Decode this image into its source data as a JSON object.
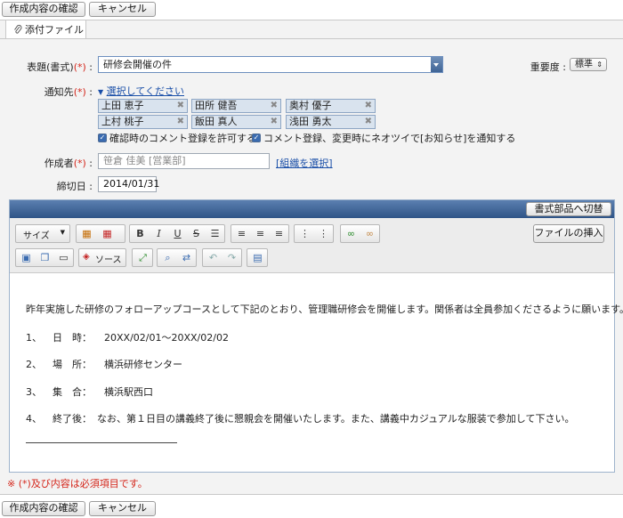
{
  "top_buttons": {
    "confirm": "作成内容の確認",
    "cancel": "キャンセル"
  },
  "tab": {
    "label": "添付ファイル"
  },
  "form": {
    "title_label": "表題(書式)",
    "required_mark": "(*)",
    "colon": ":",
    "title_value": "研修会開催の件",
    "importance_label": "重要度",
    "importance_value": "標準",
    "notify_label": "通知先",
    "notify_select_link": "選択してください",
    "recipients": [
      "上田 恵子",
      "田所 健吾",
      "奥村 優子",
      "上村 桃子",
      "飯田 真人",
      "浅田 勇太"
    ],
    "allow_comment_label": "確認時のコメント登録を許可する",
    "notify_new_label": "コメント登録、変更時にネオツイで[お知らせ]を通知する",
    "author_label": "作成者",
    "author_value": "笹倉 佳美 [営業部]",
    "org_select_link": "[組織を選択]",
    "deadline_label": "締切日",
    "deadline_value": "2014/01/31"
  },
  "editor": {
    "switch_button": "書式部品へ切替",
    "size_select": "サイズ",
    "insert_file_button": "ファイルの挿入",
    "source_button": "ソース",
    "body": {
      "intro": "昨年実施した研修のフォローアップコースとして下記のとおり、管理職研修会を開催します。関係者は全員参加くださるように願います。",
      "items": [
        {
          "num": "1、",
          "key": "日　時：",
          "value": "20XX/02/01〜20XX/02/02"
        },
        {
          "num": "2、",
          "key": "場　所：",
          "value": "横浜研修センター"
        },
        {
          "num": "3、",
          "key": "集　合：",
          "value": "横浜駅西口"
        },
        {
          "num": "4、",
          "key": "終了後：",
          "value": "なお、第１日目の講義終了後に懇親会を開催いたします。また、講義中カジュアルな服装で参加して下さい。"
        }
      ]
    }
  },
  "footer_note": "※ (*)及び内容は必須項目です。",
  "colors": {
    "required": "#d4251a",
    "accent": "#2f5487",
    "link": "#1a4fa8"
  }
}
